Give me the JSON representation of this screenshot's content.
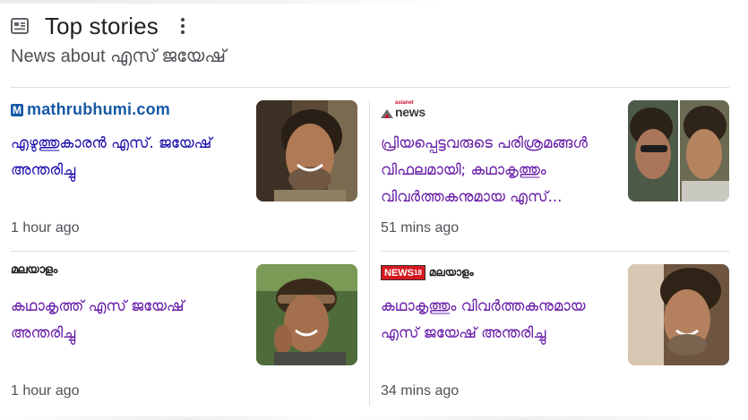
{
  "header": {
    "title": "Top stories",
    "subtitle": "News about എസ് ജയേഷ്"
  },
  "stories": [
    {
      "source": "mathrubhumi.com",
      "source_logo_letter": "M",
      "headline": "എഴുത്തുകാരൻ എസ്. ജയേഷ് അന്തരിച്ചു",
      "time": "1 hour ago",
      "thumb_icon": "portrait-photo"
    },
    {
      "source_small": "asianet",
      "source": "news",
      "headline": "പ്രിയപ്പെട്ടവരുടെ പരിശ്രമങ്ങൾ വിഫലമായി; കഥാകൃത്തും വിവർത്തകനുമായ എസ്...",
      "time": "51 mins ago",
      "thumb_icon": "portrait-photo"
    },
    {
      "source": "മലയാളം",
      "headline": "കഥാകൃത്ത് എസ് ജയേഷ് അന്തരിച്ചു",
      "time": "1 hour ago",
      "thumb_icon": "portrait-photo"
    },
    {
      "source_badge": "NEWS",
      "source_badge_sup": "18",
      "source": "മലയാളം",
      "headline": "കഥാകൃത്തും വിവർത്തകനുമായ എസ് ജയേഷ് അന്തരിച്ചു",
      "time": "34 mins ago",
      "thumb_icon": "portrait-photo"
    }
  ],
  "colors": {
    "link": "#1a0dab",
    "visited": "#681da8",
    "secondary_text": "#4d5156",
    "divider": "#dadce0"
  }
}
